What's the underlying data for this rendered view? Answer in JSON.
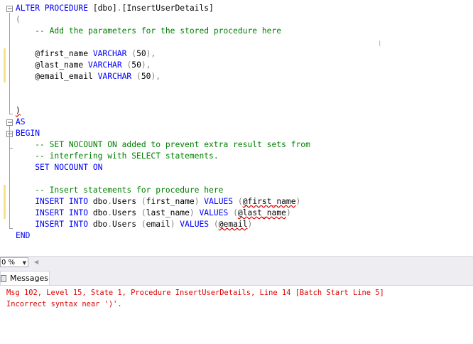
{
  "editor": {
    "lines": [
      {
        "parts": [
          {
            "t": "ALTER PROCEDURE ",
            "c": "kw"
          },
          {
            "t": "[dbo]",
            "c": ""
          },
          {
            "t": ".",
            "c": "gr"
          },
          {
            "t": "[InsertUserDetails]",
            "c": ""
          }
        ]
      },
      {
        "parts": [
          {
            "t": "(",
            "c": "gr"
          }
        ]
      },
      {
        "parts": [
          {
            "t": "    -- Add the parameters for the stored procedure here",
            "c": "cm"
          }
        ]
      },
      {
        "parts": []
      },
      {
        "parts": [
          {
            "t": "    @first_name ",
            "c": ""
          },
          {
            "t": "VARCHAR ",
            "c": "kw"
          },
          {
            "t": "(",
            "c": "gr"
          },
          {
            "t": "50",
            "c": ""
          },
          {
            "t": "),",
            "c": "gr"
          }
        ]
      },
      {
        "parts": [
          {
            "t": "    @last_name ",
            "c": ""
          },
          {
            "t": "VARCHAR ",
            "c": "kw"
          },
          {
            "t": "(",
            "c": "gr"
          },
          {
            "t": "50",
            "c": ""
          },
          {
            "t": "),",
            "c": "gr"
          }
        ]
      },
      {
        "parts": [
          {
            "t": "    @email_email ",
            "c": ""
          },
          {
            "t": "VARCHAR ",
            "c": "kw"
          },
          {
            "t": "(",
            "c": "gr"
          },
          {
            "t": "50",
            "c": ""
          },
          {
            "t": "),",
            "c": "gr"
          }
        ]
      },
      {
        "parts": []
      },
      {
        "parts": [
          {
            "t": ")",
            "c": "gr err"
          }
        ]
      },
      {
        "parts": [
          {
            "t": "AS",
            "c": "kw"
          }
        ]
      },
      {
        "parts": [
          {
            "t": "BEGIN",
            "c": "kw"
          }
        ]
      },
      {
        "parts": [
          {
            "t": "    -- SET NOCOUNT ON added to prevent extra result sets from",
            "c": "cm"
          }
        ]
      },
      {
        "parts": [
          {
            "t": "    -- interfering with SELECT statements.",
            "c": "cm"
          }
        ]
      },
      {
        "parts": [
          {
            "t": "    SET NOCOUNT ON",
            "c": "kw"
          }
        ]
      },
      {
        "parts": []
      },
      {
        "parts": [
          {
            "t": "    -- Insert statements for procedure here",
            "c": "cm"
          }
        ]
      },
      {
        "parts": [
          {
            "t": "    INSERT INTO ",
            "c": "kw"
          },
          {
            "t": "dbo",
            "c": ""
          },
          {
            "t": ".",
            "c": "gr"
          },
          {
            "t": "Users ",
            "c": ""
          },
          {
            "t": "(",
            "c": "gr"
          },
          {
            "t": "first_name",
            "c": ""
          },
          {
            "t": ") ",
            "c": "gr"
          },
          {
            "t": "VALUES ",
            "c": "kw"
          },
          {
            "t": "(",
            "c": "gr"
          },
          {
            "t": "@first_name",
            "c": "err"
          },
          {
            "t": ")",
            "c": "gr"
          }
        ]
      },
      {
        "parts": [
          {
            "t": "    INSERT INTO ",
            "c": "kw"
          },
          {
            "t": "dbo",
            "c": ""
          },
          {
            "t": ".",
            "c": "gr"
          },
          {
            "t": "Users ",
            "c": ""
          },
          {
            "t": "(",
            "c": "gr"
          },
          {
            "t": "last_name",
            "c": ""
          },
          {
            "t": ") ",
            "c": "gr"
          },
          {
            "t": "VALUES ",
            "c": "kw"
          },
          {
            "t": "(",
            "c": "gr"
          },
          {
            "t": "@last_name",
            "c": "err"
          },
          {
            "t": ")",
            "c": "gr"
          }
        ]
      },
      {
        "parts": [
          {
            "t": "    INSERT INTO ",
            "c": "kw"
          },
          {
            "t": "dbo",
            "c": ""
          },
          {
            "t": ".",
            "c": "gr"
          },
          {
            "t": "Users ",
            "c": ""
          },
          {
            "t": "(",
            "c": "gr"
          },
          {
            "t": "email",
            "c": ""
          },
          {
            "t": ") ",
            "c": "gr"
          },
          {
            "t": "VALUES ",
            "c": "kw"
          },
          {
            "t": "(",
            "c": "gr"
          },
          {
            "t": "@email",
            "c": "err"
          },
          {
            "t": ")",
            "c": "gr"
          }
        ]
      },
      {
        "parts": [
          {
            "t": "END",
            "c": "kw"
          }
        ]
      }
    ]
  },
  "statusbar": {
    "zoom_value": "0 %",
    "zoom_arrow_icon": "chevron-down-icon",
    "scroll_left_icon": "scroll-left-arrow-icon"
  },
  "results_tabs": {
    "messages_label": "Messages",
    "messages_icon": "messages-icon"
  },
  "messages": {
    "line1": "Msg 102, Level 15, State 1, Procedure InsertUserDetails, Line 14 [Batch Start Line 5]",
    "line2": "Incorrect syntax near ')'."
  },
  "colors": {
    "keyword": "#0000ff",
    "comment": "#008000",
    "operator": "#808080",
    "error_text": "#e00000",
    "change_marker": "#f7e18b"
  }
}
